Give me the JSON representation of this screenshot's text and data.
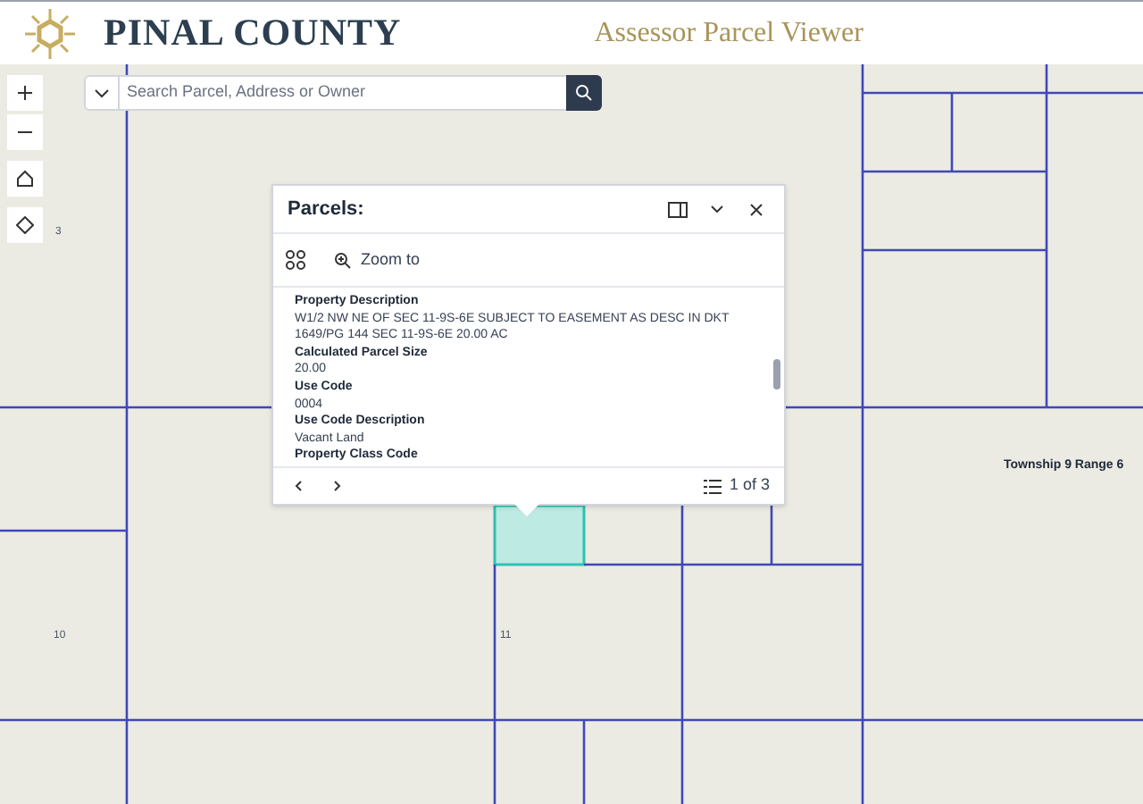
{
  "header": {
    "title": "PINAL COUNTY",
    "subtitle": "Assessor Parcel Viewer"
  },
  "search": {
    "placeholder": "Search Parcel, Address or Owner"
  },
  "popup": {
    "title": "Parcels:",
    "actions": [
      {
        "label": "Zoom to"
      }
    ],
    "fields": [
      {
        "label": "Property Description",
        "value": "W1/2 NW NE OF SEC 11-9S-6E SUBJECT TO EASEMENT AS DESC IN DKT 1649/PG 144 SEC 11-9S-6E 20.00 AC"
      },
      {
        "label": "Calculated Parcel Size",
        "value": "20.00"
      },
      {
        "label": "Use Code",
        "value": "0004"
      },
      {
        "label": "Use Code Description",
        "value": "Vacant Land"
      },
      {
        "label": "Property Class Code"
      }
    ],
    "pagination": "1 of 3"
  },
  "map_labels": [
    "3",
    "10",
    "11",
    "Township 9 Range 6"
  ]
}
